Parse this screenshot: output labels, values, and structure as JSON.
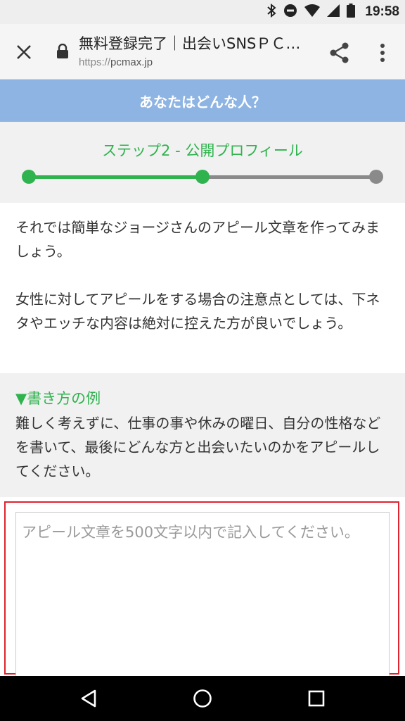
{
  "status_bar": {
    "time": "19:58"
  },
  "browser": {
    "title": "無料登録完了｜出会いSNSＰＣ…",
    "url_scheme": "https://",
    "url_host": "pcmax.jp"
  },
  "header": {
    "title": "あなたはどんな人？"
  },
  "step": {
    "title": "ステップ2 - 公開プロフィール",
    "progress": 0.5
  },
  "intro": {
    "paragraph1": "それでは簡単なジョージさんのアピール文章を作ってみましょう。",
    "paragraph2": "女性に対してアピールをする場合の注意点としては、下ネタやエッチな内容は絶対に控えた方が良いでしょう。"
  },
  "example": {
    "heading": "▼書き方の例",
    "body": "難しく考えずに、仕事の事や休みの曜日、自分の性格などを書いて、最後にどんな方と出会いたいのかをアピールしてください。"
  },
  "appeal_input": {
    "value": "",
    "placeholder": "アピール文章を500文字以内で記入してください。"
  },
  "colors": {
    "accent_green": "#2fb34e",
    "header_blue": "#8db4e2",
    "highlight_red": "#e0232e"
  },
  "icons": {
    "status": [
      "bluetooth-icon",
      "do-not-disturb-icon",
      "wifi-icon",
      "signal-icon",
      "battery-icon"
    ],
    "toolbar": [
      "close-icon",
      "lock-icon",
      "share-icon",
      "more-vert-icon"
    ],
    "nav": [
      "back-icon",
      "home-icon",
      "recents-icon"
    ]
  }
}
